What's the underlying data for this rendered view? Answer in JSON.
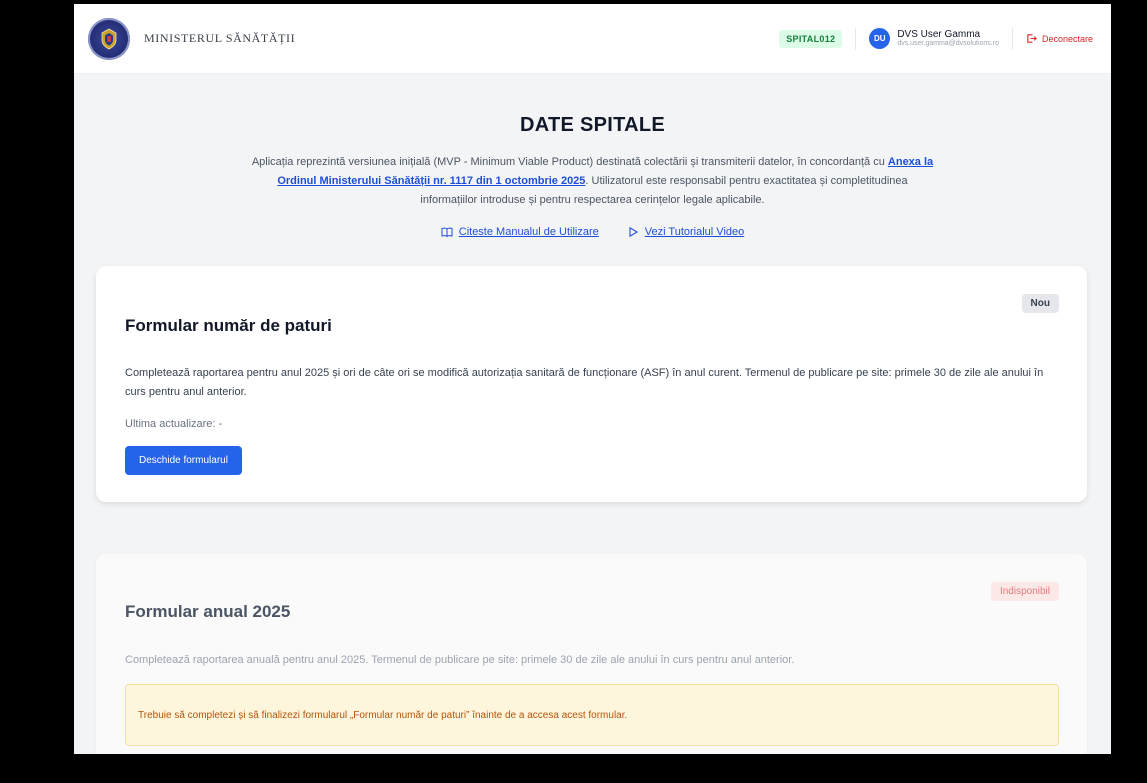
{
  "header": {
    "ministry_name": "MINISTERUL SĂNĂTĂȚII",
    "hospital_code": "SPITAL012",
    "user": {
      "initials": "DU",
      "name": "DVS User Gamma",
      "email": "dvs.user.gamma@dvsolutions.ro"
    },
    "logout_label": "Deconectare"
  },
  "hero": {
    "title": "DATE SPITALE",
    "desc_before": "Aplicația reprezintă versiunea inițială (MVP - Minimum Viable Product) destinată colectării și transmiterii datelor, în concordanță cu ",
    "desc_link": "Anexa la Ordinul Ministerului Sănătății nr. 1117 din 1 octombrie 2025",
    "desc_after": ". Utilizatorul este responsabil pentru exactitatea și completitudinea informațiilor introduse și pentru respectarea cerințelor legale aplicabile.",
    "manual_link": "Citeste Manualul de Utilizare",
    "video_link": "Vezi Tutorialul Video"
  },
  "forms": [
    {
      "title": "Formular număr de paturi",
      "badge": "Nou",
      "description": "Completează raportarea pentru anul 2025 și ori de câte ori se modifică autorizația sanitară de funcționare (ASF) în anul curent. Termenul de publicare pe site: primele 30 de zile ale anului în curs pentru anul anterior.",
      "last_update": "Ultima actualizare: -",
      "button_label": "Deschide formularul"
    },
    {
      "title": "Formular anual 2025",
      "badge": "Indisponibil",
      "description": "Completează raportarea anuală pentru anul 2025. Termenul de publicare pe site: primele 30 de zile ale anului în curs pentru anul anterior.",
      "warning": "Trebuie să completezi și să finalizezi formularul „Formular număr de paturi” înainte de a accesa acest formular."
    }
  ],
  "colors": {
    "primary": "#2563eb",
    "danger": "#dc2626",
    "success": "#15803d"
  }
}
